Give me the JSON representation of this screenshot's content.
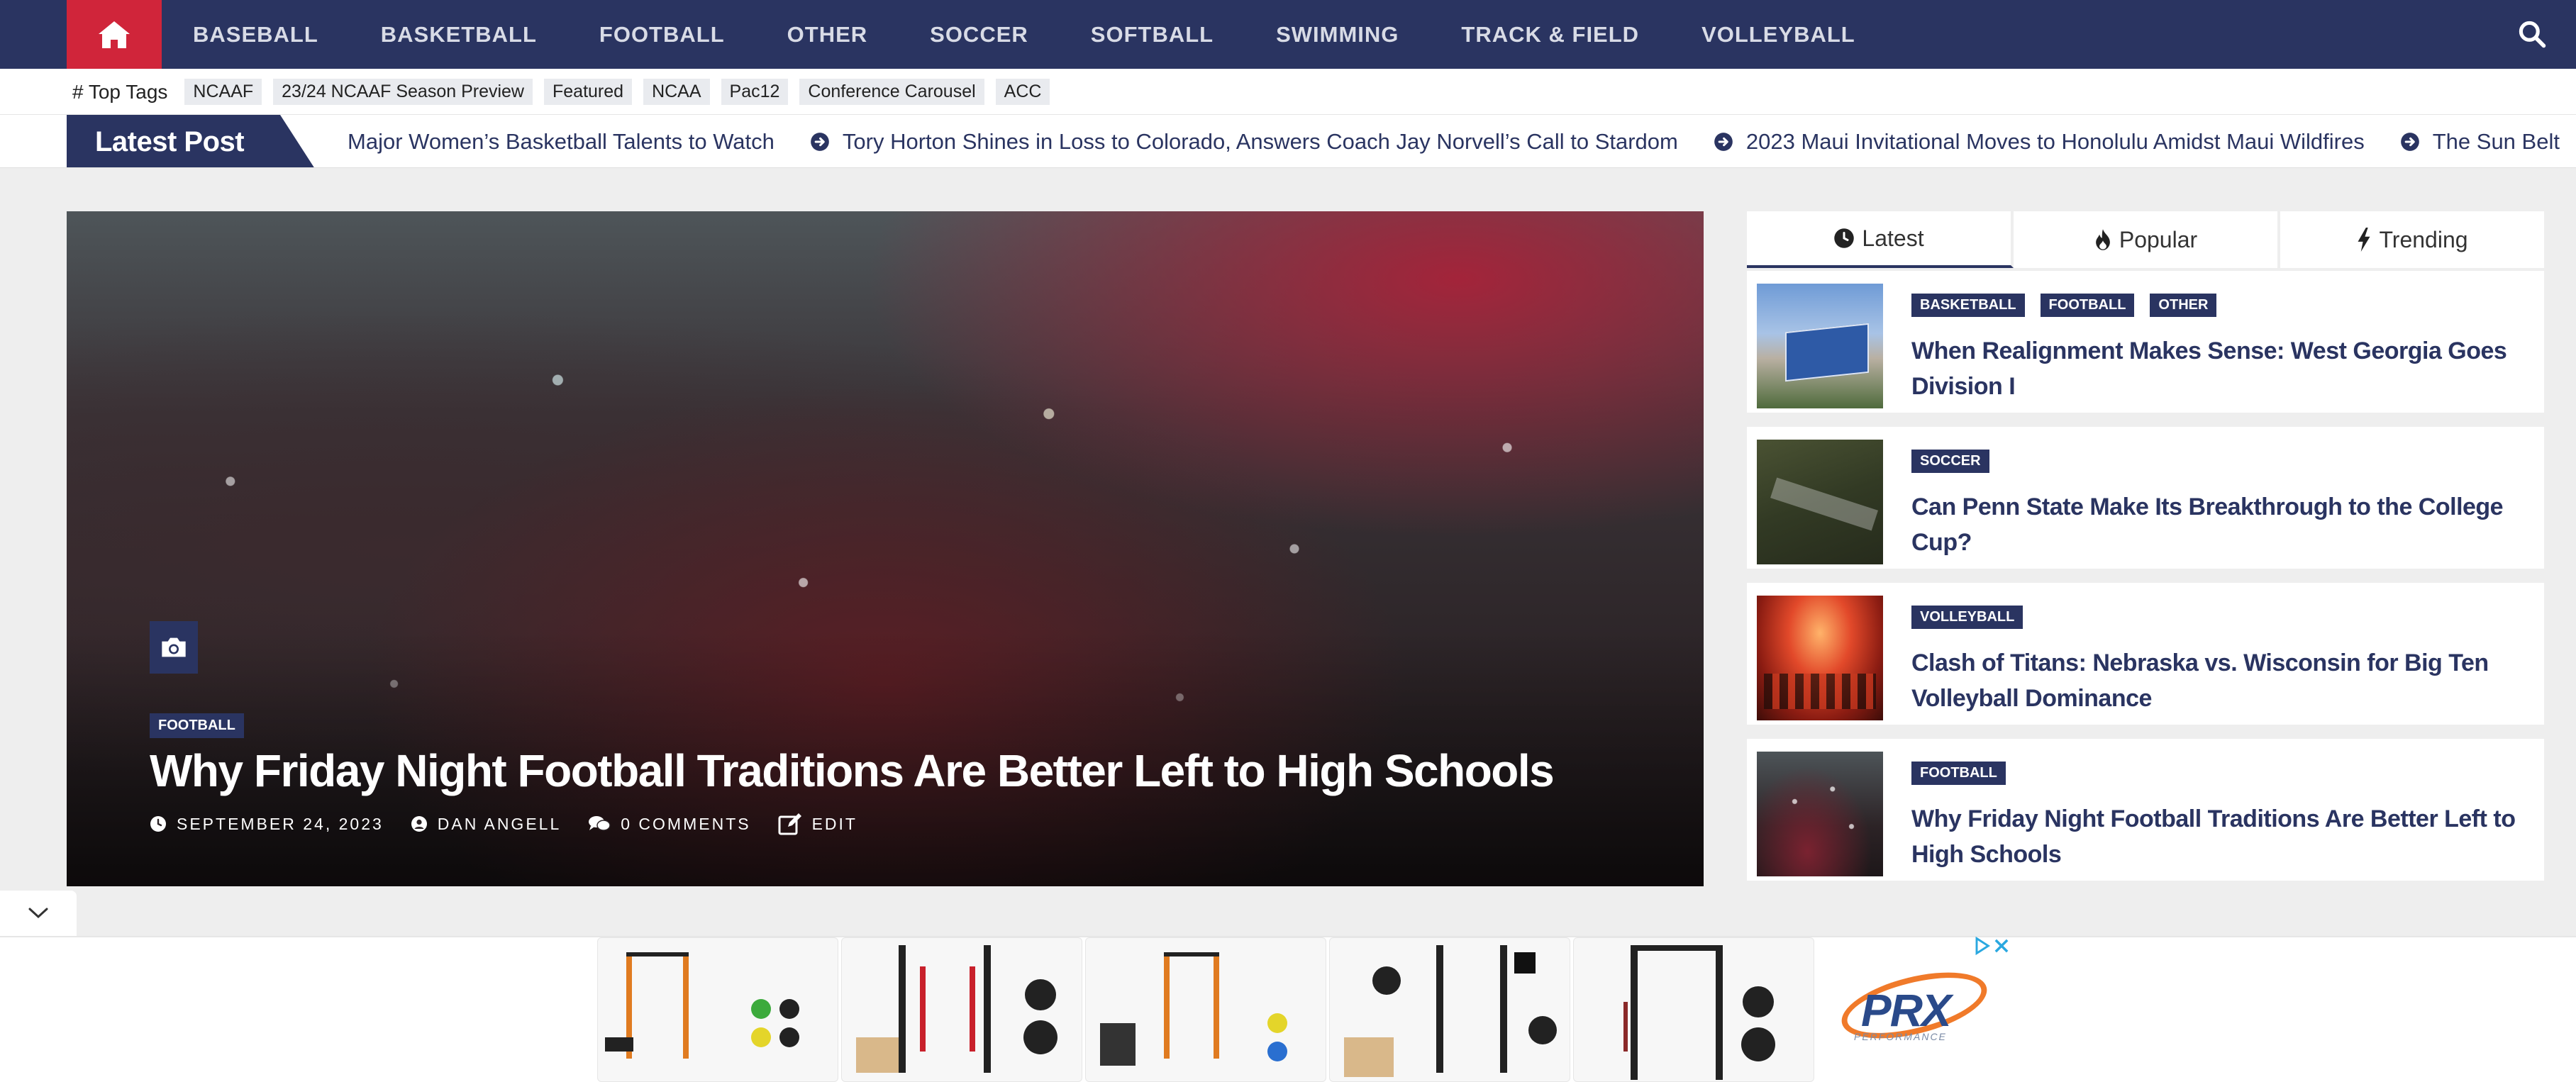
{
  "nav": {
    "items": [
      "BASEBALL",
      "BASKETBALL",
      "FOOTBALL",
      "OTHER",
      "SOCCER",
      "SOFTBALL",
      "SWIMMING",
      "TRACK & FIELD",
      "VOLLEYBALL"
    ],
    "home_icon": "home-icon",
    "search_icon": "search-icon"
  },
  "tags": {
    "title": "# Top Tags",
    "items": [
      "NCAAF",
      "23/24 NCAAF Season Preview",
      "Featured",
      "NCAA",
      "Pac12",
      "Conference Carousel",
      "ACC"
    ]
  },
  "ticker": {
    "label": "Latest Post",
    "items": [
      "Major Women’s Basketball Talents to Watch",
      "Tory Horton Shines in Loss to Colorado, Answers Coach Jay Norvell’s Call to Stardom",
      "2023 Maui Invitational Moves to Honolulu Amidst Maui Wildfires",
      "The Sun Belt"
    ]
  },
  "hero": {
    "category": "FOOTBALL",
    "title": "Why Friday Night Football Traditions Are Better Left to High Schools",
    "date": "SEPTEMBER 24, 2023",
    "author": "DAN ANGELL",
    "comments": "0 COMMENTS",
    "edit": "EDIT"
  },
  "sidebar": {
    "tabs": [
      "Latest",
      "Popular",
      "Trending"
    ],
    "posts": [
      {
        "categories": [
          "BASKETBALL",
          "FOOTBALL",
          "OTHER"
        ],
        "title": "When Realignment Makes Sense: West Georgia Goes Division I"
      },
      {
        "categories": [
          "SOCCER"
        ],
        "title": "Can Penn State Make Its Breakthrough to the College Cup?"
      },
      {
        "categories": [
          "VOLLEYBALL"
        ],
        "title": "Clash of Titans: Nebraska vs. Wisconsin for Big Ten Volleyball Dominance"
      },
      {
        "categories": [
          "FOOTBALL"
        ],
        "title": "Why Friday Night Football Traditions Are Better Left to High Schools"
      }
    ]
  },
  "ad": {
    "brand": "PRX",
    "brand_sub": "PERFORMANCE"
  },
  "colors": {
    "navy": "#2a3461",
    "red": "#d0253a",
    "background": "#eeeeee"
  }
}
